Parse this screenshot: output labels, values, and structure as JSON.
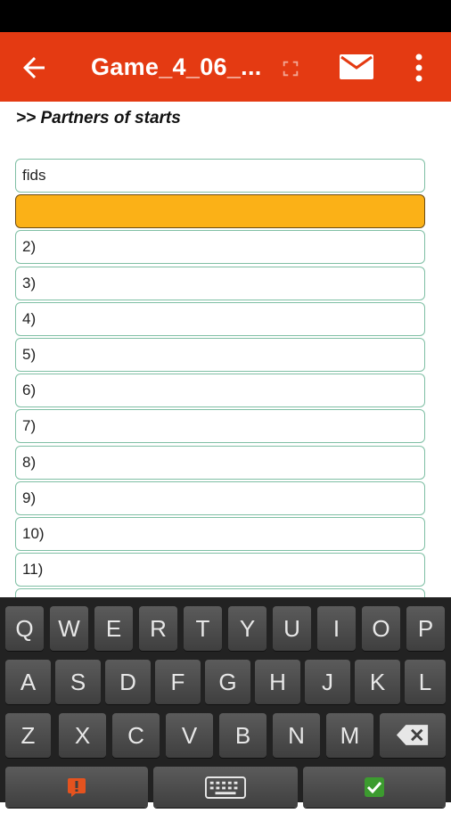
{
  "app_bar": {
    "title": "Game_4_06_...",
    "bg": "#e43a12"
  },
  "section_heading": ">> Partners of starts",
  "rows": [
    "fids",
    "",
    "2)",
    "3)",
    "4)",
    "5)",
    "6)",
    "7)",
    "8)",
    "9)",
    "10)",
    "11)",
    ""
  ],
  "keyboard": {
    "row1": [
      "Q",
      "W",
      "E",
      "R",
      "T",
      "Y",
      "U",
      "I",
      "O",
      "P"
    ],
    "row2": [
      "A",
      "S",
      "D",
      "F",
      "G",
      "H",
      "J",
      "K",
      "L"
    ],
    "row3": [
      "Z",
      "X",
      "C",
      "V",
      "B",
      "N",
      "M"
    ]
  },
  "icons": [
    "back-arrow-icon",
    "expand-icon",
    "mail-icon",
    "more-vert-icon",
    "backspace-icon",
    "help-icon",
    "keyboard-icon",
    "check-icon"
  ]
}
